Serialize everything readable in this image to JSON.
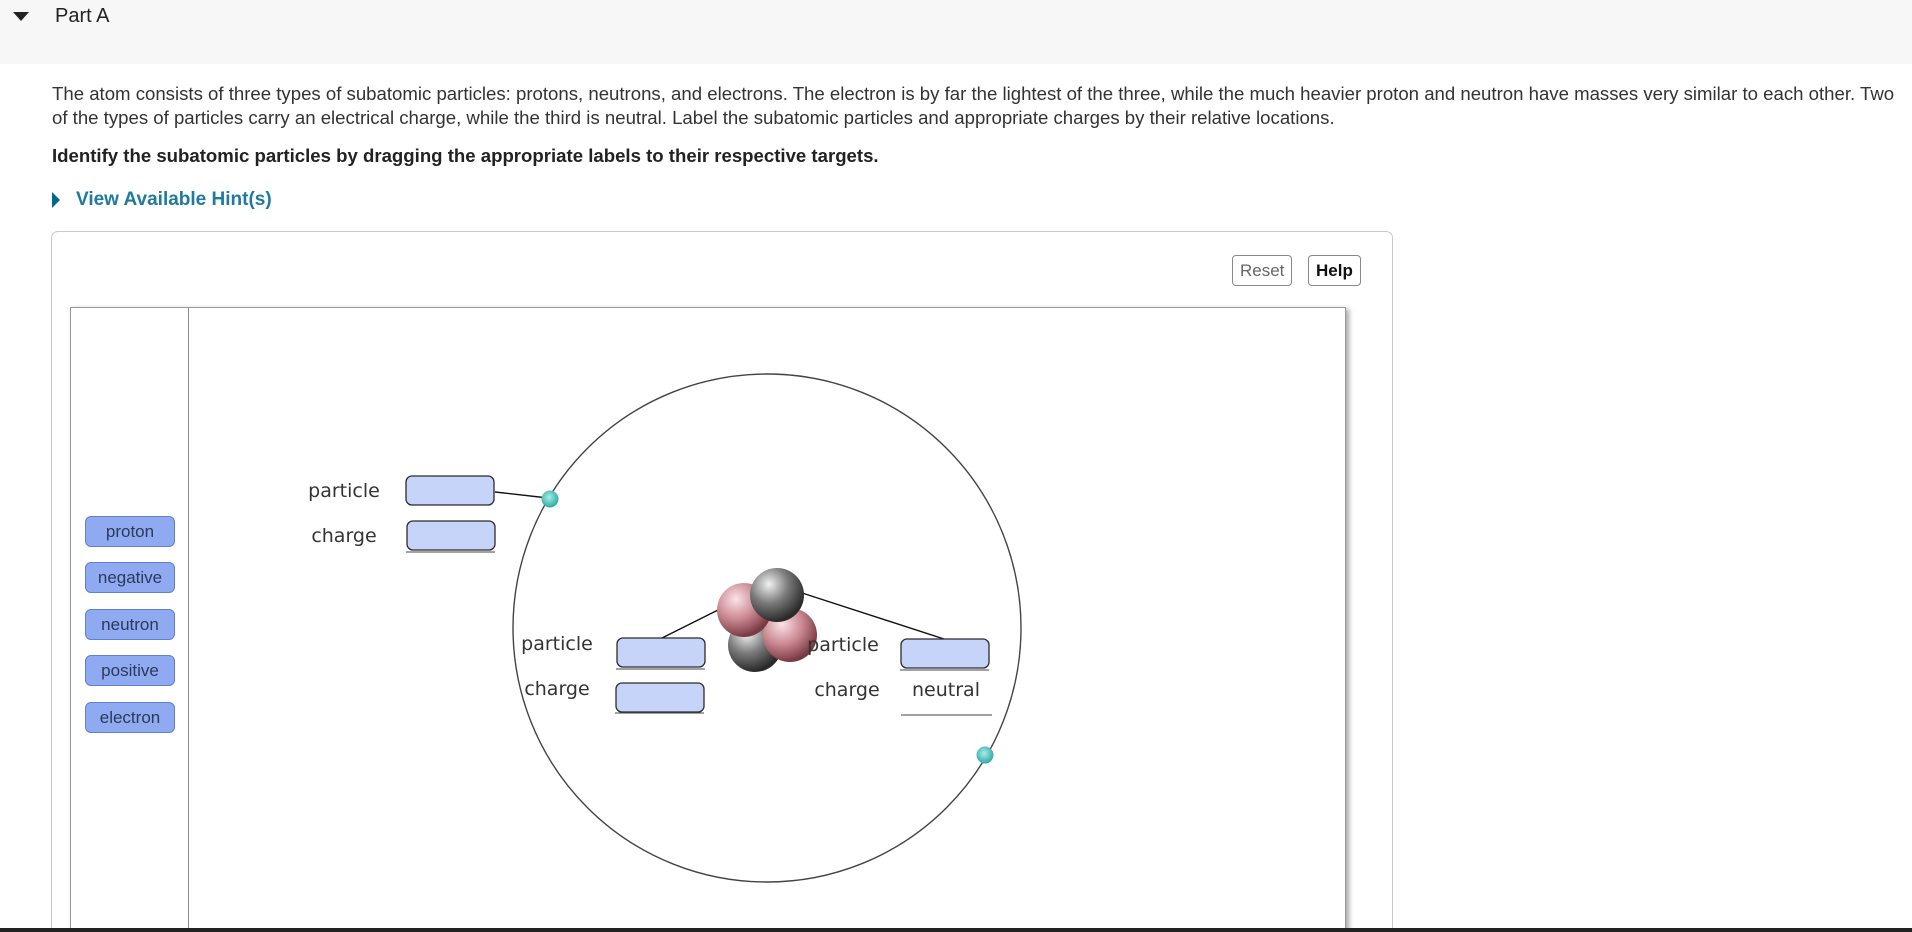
{
  "part": {
    "title": "Part A"
  },
  "question": {
    "intro": "The atom consists of three types of subatomic particles: protons, neutrons, and electrons. The electron is by far the lightest of the three, while the much heavier proton and neutron have masses very similar to each other. Two of the types of particles carry an electrical charge, while the third is neutral.  Label the subatomic particles and appropriate charges by their relative locations.",
    "instruction": "Identify the subatomic particles by dragging the appropriate labels to their respective targets."
  },
  "hints": {
    "label": "View Available Hint(s)"
  },
  "toolbar": {
    "reset": "Reset",
    "help": "Help"
  },
  "labels": [
    "proton",
    "negative",
    "neutron",
    "positive",
    "electron"
  ],
  "diagram": {
    "particle_label": "particle",
    "charge_label": "charge",
    "filled_charge": "neutral"
  },
  "colors": {
    "chip_fill": "#90aaf2",
    "target_fill": "#c5d4f8",
    "electron_dot": "#3bbfb8",
    "link": "#1f7a9e"
  }
}
